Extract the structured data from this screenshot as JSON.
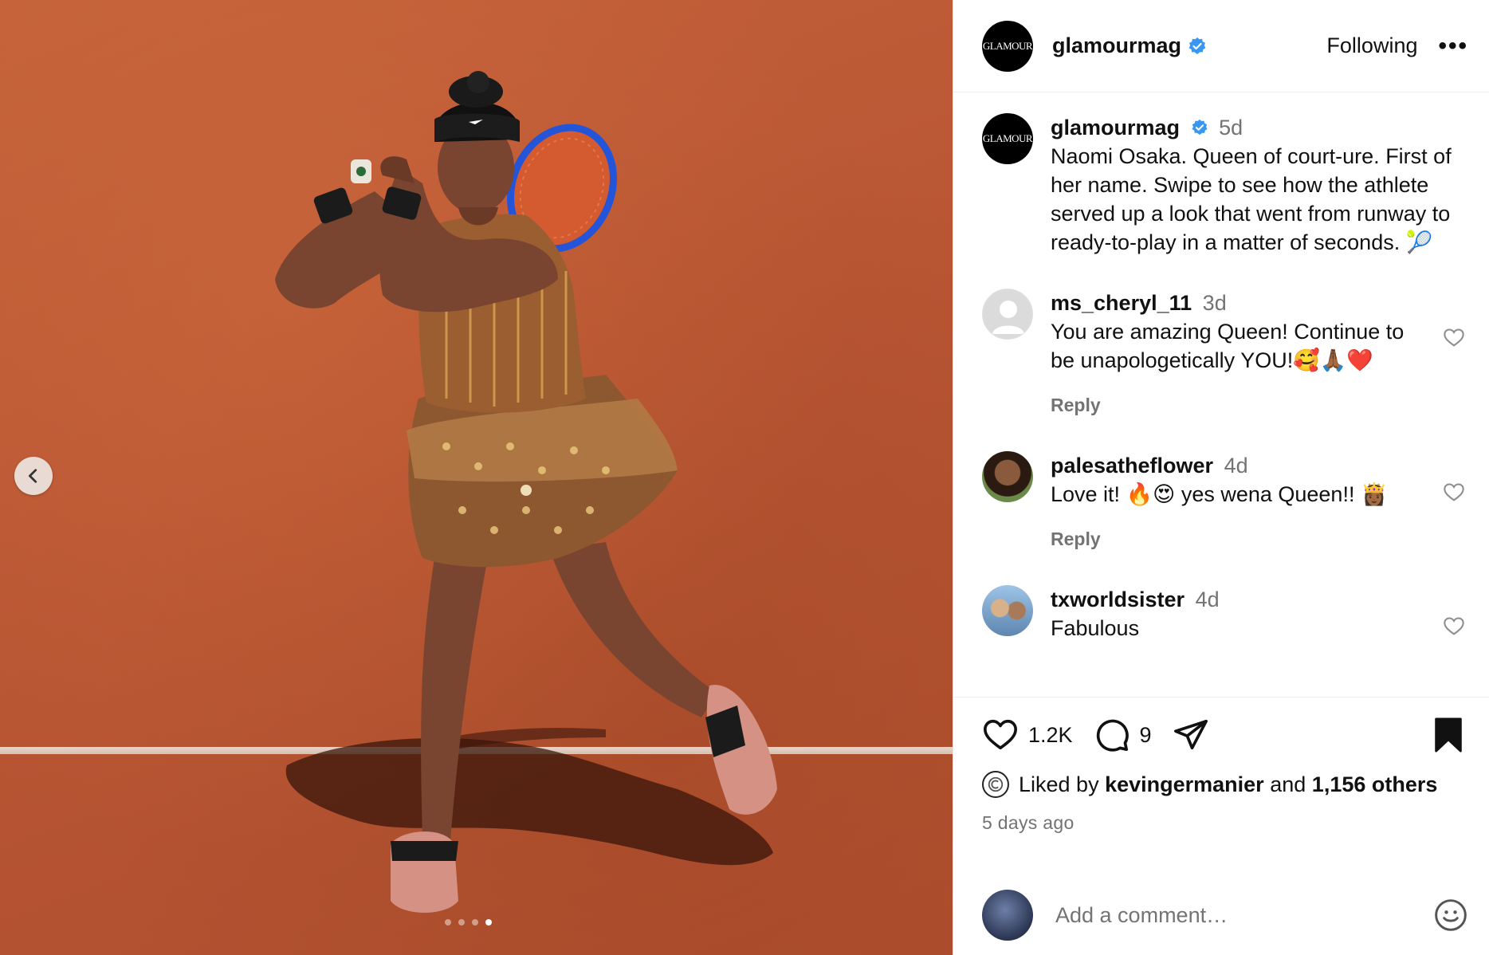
{
  "post": {
    "author": {
      "username": "glamourmag",
      "avatar_text": "GLAMOUR",
      "verified": true
    },
    "following_label": "Following",
    "more_label": "•••",
    "caption": {
      "username": "glamourmag",
      "time": "5d",
      "text": "Naomi Osaka. Queen of court-ure. First of her name. Swipe to see how the athlete served up a look that went from runway to ready-to-play in a matter of seconds. 🎾"
    },
    "comments": [
      {
        "username": "ms_cheryl_11",
        "time": "3d",
        "text": "You are amazing Queen! Continue to be unapologetically YOU!🥰🙏🏾❤️",
        "reply_label": "Reply"
      },
      {
        "username": "palesatheflower",
        "time": "4d",
        "text": "Love it! 🔥😍 yes wena Queen!! 👸🏾",
        "reply_label": "Reply"
      },
      {
        "username": "txworldsister",
        "time": "4d",
        "text": "Fabulous"
      }
    ],
    "likes_count": "1.2K",
    "comments_count": "9",
    "liked_by": {
      "prefix": "Liked by",
      "user": "kevingermanier",
      "middle": "and",
      "others": "1,156 others"
    },
    "posted_ago": "5 days ago",
    "add_comment_placeholder": "Add a comment…",
    "carousel": {
      "total": 4,
      "active_index": 4
    }
  },
  "colors": {
    "verified_blue": "#3897f0",
    "secondary_text": "#737373",
    "clay": "#b95634"
  },
  "icons": [
    "chevron-left-icon",
    "verified-badge-icon",
    "more-icon",
    "heart-icon",
    "comment-icon",
    "share-icon",
    "bookmark-icon",
    "emoji-icon"
  ]
}
